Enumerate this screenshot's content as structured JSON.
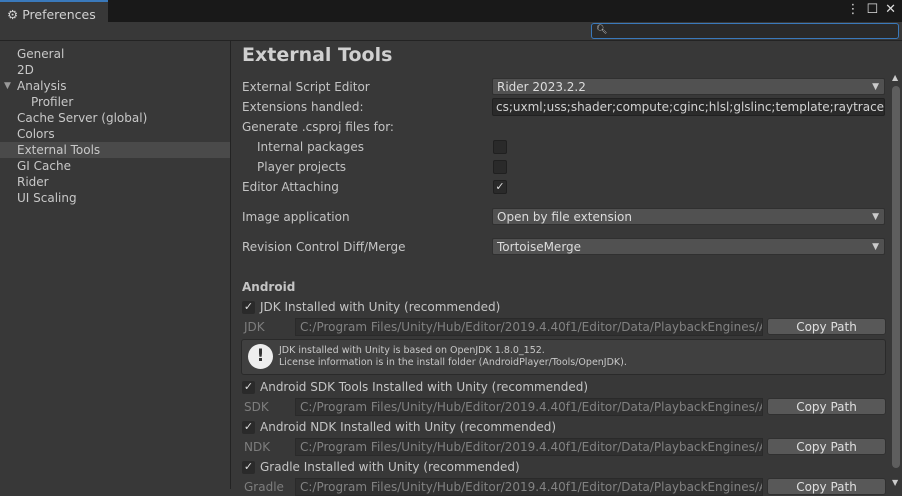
{
  "window": {
    "tab_title": "Preferences",
    "search_placeholder": ""
  },
  "sidebar": {
    "items": [
      "General",
      "2D",
      "Analysis",
      "Profiler",
      "Cache Server (global)",
      "Colors",
      "External Tools",
      "GI Cache",
      "Rider",
      "UI Scaling"
    ]
  },
  "main": {
    "title": "External Tools",
    "external_script_editor": {
      "label": "External Script Editor",
      "value": "Rider 2023.2.2"
    },
    "extensions": {
      "label": "Extensions handled:",
      "value": "cs;uxml;uss;shader;compute;cginc;hlsl;glslinc;template;raytrace;txt;xml"
    },
    "csproj": {
      "label": "Generate .csproj files for:",
      "internal": "Internal packages",
      "internal_checked": false,
      "player": "Player projects",
      "player_checked": false
    },
    "editor_attaching": {
      "label": "Editor Attaching",
      "checked": true
    },
    "image_app": {
      "label": "Image application",
      "value": "Open by file extension"
    },
    "revision": {
      "label": "Revision Control Diff/Merge",
      "value": "TortoiseMerge"
    },
    "android": {
      "header": "Android",
      "jdk": {
        "toggle": "JDK Installed with Unity (recommended)",
        "label": "JDK",
        "path": "C:/Program Files/Unity/Hub/Editor/2019.4.40f1/Editor/Data/PlaybackEngines/AndroidPlayer/OpenJDK",
        "button": "Copy Path"
      },
      "help": {
        "line1": "JDK installed with Unity is based on OpenJDK 1.8.0_152.",
        "line2": "License information is in the install folder (AndroidPlayer/Tools/OpenJDK)."
      },
      "sdk": {
        "toggle": "Android SDK Tools Installed with Unity (recommended)",
        "label": "SDK",
        "path": "C:/Program Files/Unity/Hub/Editor/2019.4.40f1/Editor/Data/PlaybackEngines/AndroidPlayer/SDK",
        "button": "Copy Path"
      },
      "ndk": {
        "toggle": "Android NDK Installed with Unity (recommended)",
        "label": "NDK",
        "path": "C:/Program Files/Unity/Hub/Editor/2019.4.40f1/Editor/Data/PlaybackEngines/AndroidPlayer/NDK",
        "button": "Copy Path"
      },
      "gradle": {
        "toggle": "Gradle Installed with Unity (recommended)",
        "label": "Gradle",
        "path": "C:/Program Files/Unity/Hub/Editor/2019.4.40f1/Editor/Data/PlaybackEngines/AndroidPlayer/Tools/gradle",
        "button": "Copy Path"
      }
    }
  }
}
